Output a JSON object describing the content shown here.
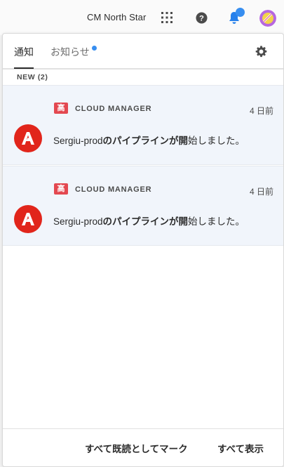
{
  "header": {
    "org_name": "CM North Star",
    "icons": [
      "apps-grid-icon",
      "help-icon",
      "bell-icon",
      "avatar"
    ],
    "accent_color": "#378ef0"
  },
  "panel": {
    "tabs": [
      {
        "label": "通知",
        "selected": true
      },
      {
        "label": "お知らせ",
        "has_unread_dot": true
      }
    ],
    "section_label": "NEW (2)",
    "notifications": [
      {
        "priority_label": "高",
        "priority_color": "#e34850",
        "source": "CLOUD MANAGER",
        "time": "4 日前",
        "icon": "adobe-logo-icon",
        "message_prefix": "Sergiu-prod",
        "message_bold": "のパイプラインが開",
        "message_suffix": "始しました。"
      },
      {
        "priority_label": "高",
        "priority_color": "#e34850",
        "source": "CLOUD MANAGER",
        "time": "4 日前",
        "icon": "adobe-logo-icon",
        "message_prefix": "Sergiu-prod",
        "message_bold": "のパイプラインが開",
        "message_suffix": "始しました。"
      }
    ],
    "footer": {
      "mark_all_read_label": "すべて既読としてマーク",
      "show_all_label": "すべて表示"
    }
  }
}
